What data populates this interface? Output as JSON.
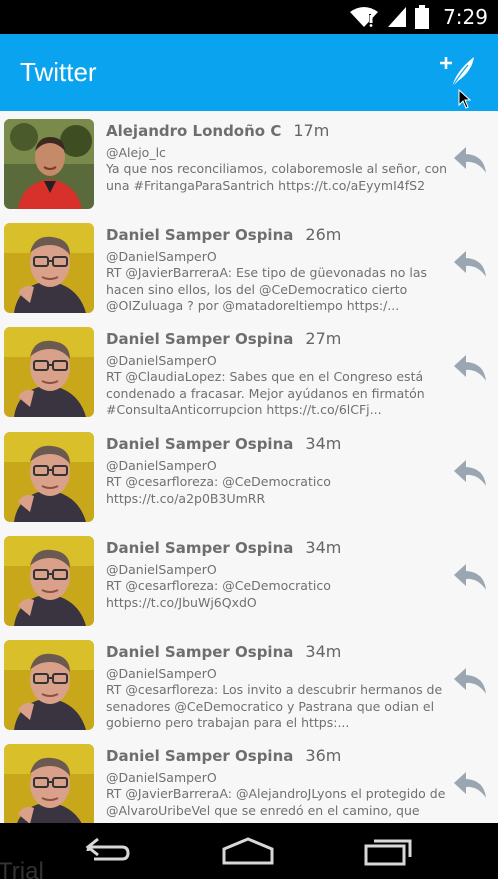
{
  "status_bar": {
    "time": "7:29",
    "icons": [
      "wifi-icon",
      "signal-icon",
      "battery-icon"
    ]
  },
  "app_bar": {
    "title": "Twitter",
    "compose_icon": "compose-tweet-icon"
  },
  "colors": {
    "app_bar": "#0aa3f0",
    "feed_bg": "#f7f7f7",
    "text": "#707070",
    "reply_icon": "#9aa6b2",
    "avatar_bg_yellow": "#c8a81a"
  },
  "tweets": [
    {
      "name": "Alejandro Londoño C",
      "time": "17m",
      "handle": "@Alejo_lc",
      "text": "Ya que nos reconciliamos, colaboremosle al señor, con una #FritangaParaSantrich https://t.co/aEyymI4fS2",
      "avatar": "avatar-photo-man-red-shirt"
    },
    {
      "name": "Daniel Samper Ospina",
      "time": "26m",
      "handle": "@DanielSamperO",
      "text": "RT @JavierBarreraA: Ese tipo de güevonadas no las hacen sino ellos, los del @CeDemocratico cierto @OIZuluaga ? por @matadoreltiempo https:/...",
      "avatar": "avatar-photo-man-glasses"
    },
    {
      "name": "Daniel Samper Ospina",
      "time": "27m",
      "handle": "@DanielSamperO",
      "text": "RT @ClaudiaLopez: Sabes que en el Congreso está condenado a fracasar. Mejor ayúdanos en firmatón #ConsultaAnticorrupcion https://t.co/6lCFj...",
      "avatar": "avatar-photo-man-glasses"
    },
    {
      "name": "Daniel Samper Ospina",
      "time": "34m",
      "handle": "@DanielSamperO",
      "text": "RT @cesarfloreza: @CeDemocratico https://t.co/a2p0B3UmRR",
      "avatar": "avatar-photo-man-glasses"
    },
    {
      "name": "Daniel Samper Ospina",
      "time": "34m",
      "handle": "@DanielSamperO",
      "text": "RT @cesarfloreza: @CeDemocratico  https://t.co/JbuWj6QxdO",
      "avatar": "avatar-photo-man-glasses"
    },
    {
      "name": "Daniel Samper Ospina",
      "time": "34m",
      "handle": "@DanielSamperO",
      "text": "RT @cesarfloreza: Los invito a descubrir hermanos de senadores @CeDemocratico y Pastrana que odian el gobierno pero trabajan para el https:...",
      "avatar": "avatar-photo-man-glasses"
    },
    {
      "name": "Daniel Samper Ospina",
      "time": "36m",
      "handle": "@DanielSamperO",
      "text": "RT @JavierBarreraA: @AlejandroJLyons el protegido de @AlvaroUribeVel que se enredó en el camino, que",
      "avatar": "avatar-photo-man-glasses"
    }
  ],
  "nav_bar": {
    "back_icon": "back-icon",
    "home_icon": "home-icon",
    "recents_icon": "recents-icon"
  },
  "watermark": "Trial"
}
